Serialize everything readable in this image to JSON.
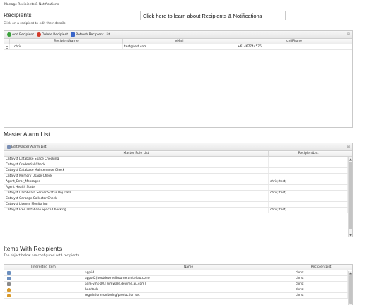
{
  "page": {
    "heading": "Manage Recipients & Notifications",
    "learn_link": "Click here to learn about Recipients & Notifications"
  },
  "recipients": {
    "title": "Recipients",
    "note": "Click on a recipient to edit their details",
    "toolbar": {
      "add": "Add Recipient",
      "delete": "Delete Recipient",
      "refresh": "Refresh Recipient List"
    },
    "columns": [
      "RecipientName",
      "eMail",
      "cellPhone"
    ],
    "rows": [
      {
        "name": "chris",
        "email": "test@test.com",
        "phone": "+61467744576"
      }
    ]
  },
  "alarm": {
    "title": "Master Alarm List",
    "toolbar": {
      "edit": "Edit Master Alarm List"
    },
    "columns": [
      "Master Rule List",
      "RecipientList"
    ],
    "rows": [
      {
        "rule": "Catalyst Database Space Checking",
        "recipient": ""
      },
      {
        "rule": "Catalyst Credential Check",
        "recipient": ""
      },
      {
        "rule": "Catalyst Database Maintenance Check",
        "recipient": ""
      },
      {
        "rule": "Catalyst Memory Usage Check",
        "recipient": ""
      },
      {
        "rule": "Agent_Error_Messages",
        "recipient": "chris; test;"
      },
      {
        "rule": "Agent Health State",
        "recipient": ""
      },
      {
        "rule": "Catalyst Dashboard Server Status Big Data",
        "recipient": "chris; test;"
      },
      {
        "rule": "Catalyst Garbage Collector Check",
        "recipient": ""
      },
      {
        "rule": "Catalyst License Monitoring",
        "recipient": ""
      },
      {
        "rule": "Catalyst Free Database Space Checking",
        "recipient": "chris; test;"
      }
    ]
  },
  "items": {
    "title": "Items With Recipients",
    "note": "The object below are configured with recipients",
    "columns": [
      "Interested Item",
      "Name",
      "RecipientList"
    ],
    "rows": [
      {
        "icon": "device-icon",
        "name": "applid",
        "recipient": "chris;"
      },
      {
        "icon": "device-icon",
        "name": "apps02(bootdev.melbourne.unitel.au.com)",
        "recipient": "chris;"
      },
      {
        "icon": "wrench-icon",
        "name": "adm-vms-003 (vmware.dev.me.au.com)",
        "recipient": "chris;"
      },
      {
        "icon": "person-icon",
        "name": "hoo task",
        "recipient": "chris;"
      },
      {
        "icon": "person-icon",
        "name": "regulationmonitoring/production set",
        "recipient": "chris;"
      }
    ]
  },
  "colors": {
    "add": "#3aa13a",
    "delete": "#d33a2a",
    "refresh": "#3a66c9",
    "border": "#c9c9c9"
  }
}
